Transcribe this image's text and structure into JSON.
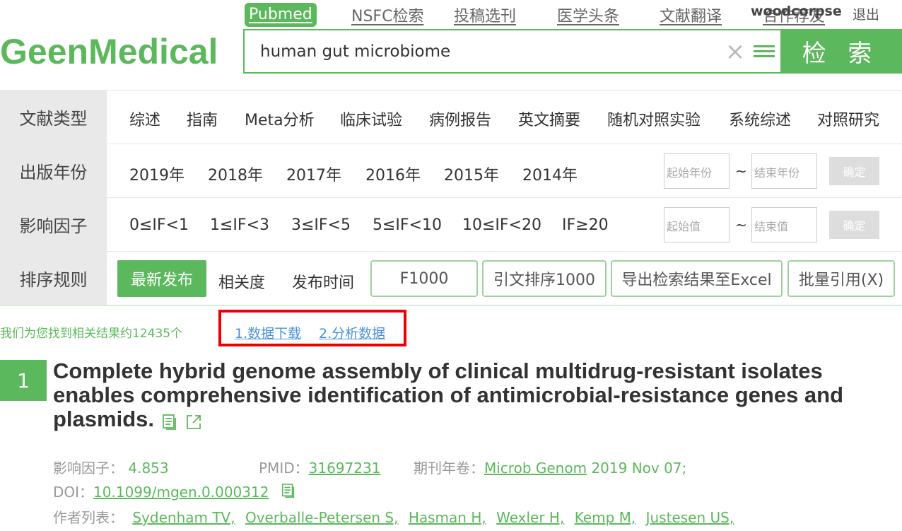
{
  "logo": "GeenMedical",
  "topnav": {
    "pubmed": "Pubmed",
    "nsfc": "NSFC检索",
    "journal_select": "投稿选刊",
    "headlines": "医学头条",
    "translate": "文献翻译",
    "hidden_item": "合作荐友",
    "user": "woodcorpse",
    "logout": "退出"
  },
  "search": {
    "value": "human gut microbiome",
    "button": "检 索"
  },
  "filters": {
    "doc_type": {
      "label": "文献类型",
      "items": [
        "综述",
        "指南",
        "Meta分析",
        "临床试验",
        "病例报告",
        "英文摘要",
        "随机对照实验",
        "系统综述",
        "对照研究"
      ]
    },
    "year": {
      "label": "出版年份",
      "items": [
        "2019年",
        "2018年",
        "2017年",
        "2016年",
        "2015年",
        "2014年"
      ],
      "start_placeholder": "起始年份",
      "end_placeholder": "结束年份",
      "tilde": "~",
      "confirm": "确定"
    },
    "impact": {
      "label": "影响因子",
      "items": [
        "0≤IF<1",
        "1≤IF<3",
        "3≤IF<5",
        "5≤IF<10",
        "10≤IF<20",
        "IF≥20"
      ],
      "start_placeholder": "起始值",
      "end_placeholder": "结束值",
      "tilde": "~",
      "confirm": "确定"
    },
    "sort": {
      "label": "排序规则",
      "active": "最新发布",
      "relevance": "相关度",
      "pub_time": "发布时间",
      "f1000": "F1000",
      "citation": "引文排序1000",
      "export": "导出检索结果至Excel",
      "batch_cite": "批量引用(X)"
    }
  },
  "results": {
    "count_text": "我们为您找到相关结果约12435个",
    "download": "1.数据下载",
    "analyze": "2.分析数据"
  },
  "article": {
    "rank": "1",
    "title": "Complete hybrid genome assembly of clinical multidrug-resistant isolates enables comprehensive identification of antimicrobial-resistance genes and plasmids.",
    "if_label": "影响因子：",
    "if_value": "4.853",
    "pmid_label": "PMID：",
    "pmid": "31697231",
    "journal_label": "期刊年卷：",
    "journal": "Microb Genom",
    "journal_date": "2019 Nov 07;",
    "doi_label": "DOI：",
    "doi": "10.1099/mgen.0.000312",
    "authors_label": "作者列表：",
    "authors": [
      "Sydenham TV,",
      "Overballe-Petersen S,",
      "Hasman H,",
      "Wexler H,",
      "Kemp M,",
      "Justesen US,"
    ]
  },
  "colors": {
    "brand": "#5cb85c",
    "highlight_box": "#ee0000",
    "link": "#4a90d9"
  }
}
